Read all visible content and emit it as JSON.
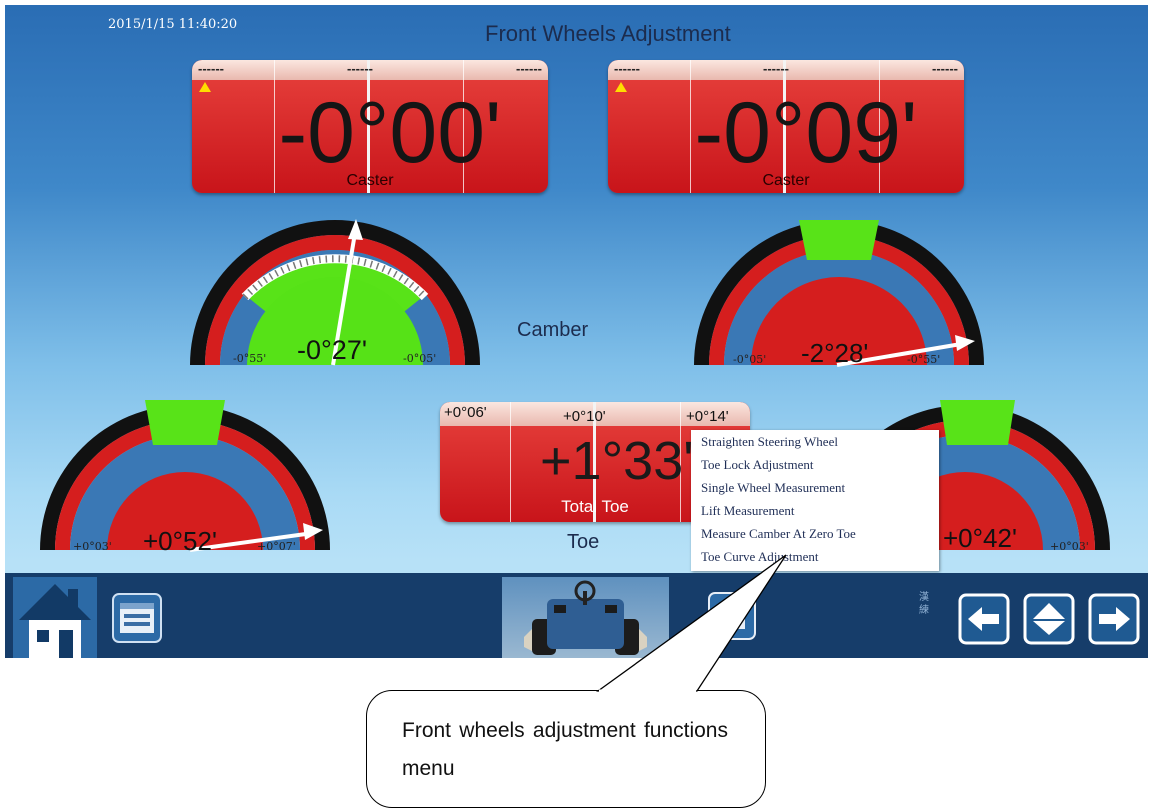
{
  "header": {
    "datetime": "2015/1/15 11:40:20",
    "title": "Front Wheels Adjustment"
  },
  "caster_left": {
    "limits": [
      "------",
      "------",
      "------"
    ],
    "value": "-0°00'",
    "label": "Caster"
  },
  "caster_right": {
    "limits": [
      "------",
      "------",
      "------"
    ],
    "value": "-0°09'",
    "label": "Caster"
  },
  "camber": {
    "label": "Camber",
    "left": {
      "value": "-0°27'",
      "min": "-0°55'",
      "max": "-0°05'"
    },
    "right": {
      "value": "-2°28'",
      "min": "-0°05'",
      "max": "-0°55'"
    }
  },
  "toe": {
    "label": "Toe",
    "total": {
      "limits": [
        "+0°06'",
        "+0°10'",
        "+0°14'"
      ],
      "value": "+1°33'",
      "label": "Total Toe"
    },
    "left": {
      "value": "+0°52'",
      "min": "+0°03'",
      "max": "+0°07'"
    },
    "right": {
      "value": "+0°42'",
      "max": "+0°03'"
    }
  },
  "menu": {
    "items": [
      "Straighten Steering Wheel",
      "Toe Lock Adjustment",
      "Single Wheel Measurement",
      "Lift Measurement",
      "Measure Camber At Zero Toe",
      "Toe Curve Adjustment"
    ]
  },
  "toolbar": {
    "cjk_label": "漢練"
  },
  "callout": {
    "text": "Front wheels adjustment functions menu"
  },
  "icons": {
    "home": "home-icon",
    "menu": "list-window-icon",
    "car": "vehicle-front-axle-icon",
    "left": "arrow-left-icon",
    "center": "diamond-up-down-icon",
    "right": "arrow-right-icon"
  },
  "colors": {
    "background_top": "#2a6db4",
    "panel_red": "#d42a2a",
    "gauge_green": "#5ee81c",
    "toolbar": "#163d6a"
  }
}
